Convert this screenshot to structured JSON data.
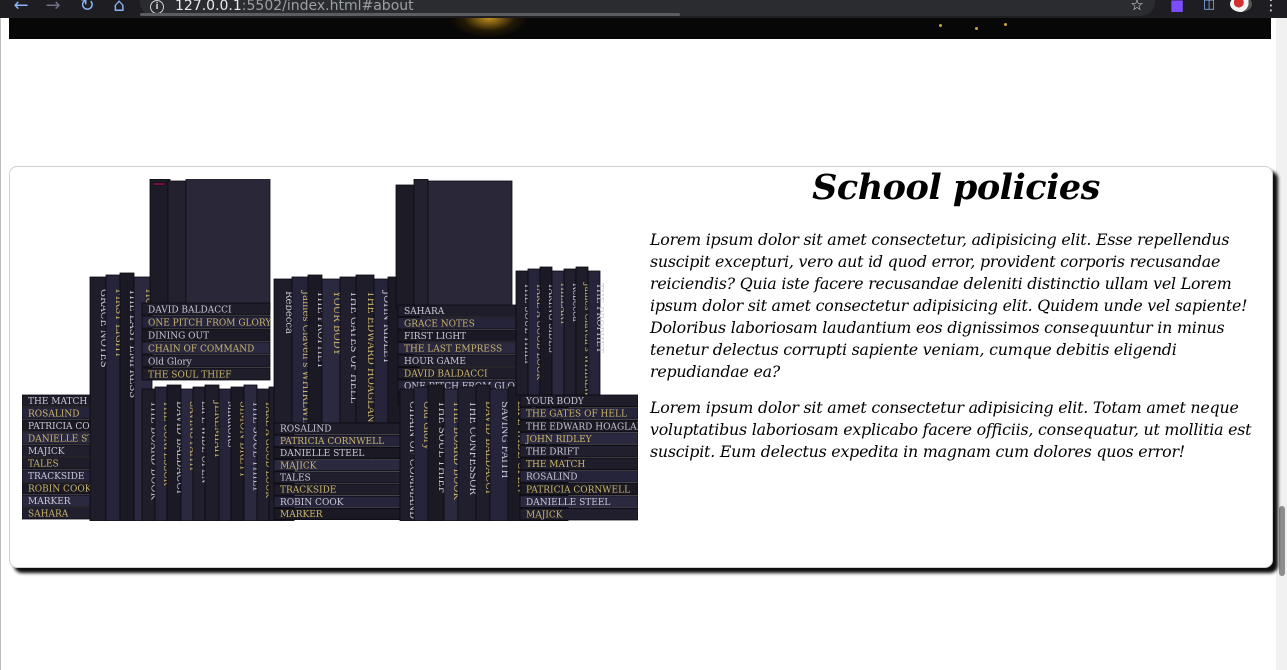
{
  "browser": {
    "url_host": "127.0.0.1",
    "url_rest": ":5502/index.html#about",
    "colors": {
      "chrome_bg": "#1e1e22",
      "omnibox_bg": "#2b2c30",
      "accent": "#8ab4f8",
      "extension": "#7c4dff"
    },
    "icons": [
      "back-arrow-icon",
      "forward-arrow-icon",
      "reload-icon",
      "home-icon",
      "info-icon",
      "star-icon",
      "puzzle-extension-icon",
      "cast-icon",
      "menu-dots-icon"
    ]
  },
  "about": {
    "title": "School policies",
    "paragraphs": [
      "Lorem ipsum dolor sit amet consectetur, adipisicing elit. Esse repellendus suscipit excepturi, vero aut id quod error, provident corporis recusandae reiciendis? Quia iste facere recusandae deleniti distinctio ullam vel Lorem ipsum dolor sit amet consectetur adipisicing elit. Quidem unde vel sapiente! Doloribus laboriosam laudantium eos dignissimos consequuntur in minus tenetur delectus corrupti sapiente veniam, cumque debitis eligendi repudiandae ea?",
      "Lorem ipsum dolor sit amet consectetur adipisicing elit. Totam amet neque voluptatibus laboriosam explicabo facere officiis, consequatur, ut mollitia est suscipit. Eum delectus expedita in magnam cum dolores quos error!"
    ],
    "image": {
      "subject": "black-books-stacks",
      "spine_titles": [
        "THE MATCH",
        "ROSALIND",
        "PATRICIA CORNWELL",
        "DANIELLE STEEL",
        "MAJICK",
        "TALES",
        "TRACKSIDE",
        "ROBIN COOK",
        "MARKER",
        "SAHARA",
        "GRACE NOTES",
        "FIRST LIGHT",
        "THE LAST EMPRESS",
        "HOUR GAME",
        "DAVID BALDACCI",
        "ONE PITCH FROM GLORY",
        "DINING OUT",
        "CHAIN OF COMMAND",
        "Old Glory",
        "THE SOUL THIEF",
        "THE BOARD BOOK",
        "THE CONFESSOR",
        "DAVID BALDACCI",
        "SAVING FAITH",
        "LIFE WIDE OPEN",
        "JEREMIAH",
        "MIRRORS",
        "SIMON BRETT",
        "THE SOUL THIEF",
        "TAKE A GOOD LOOK",
        "TAKING SIDES",
        "HILLARY",
        "Rebecca",
        "James Clavell's WHIRLWIND",
        "THE PROPHET",
        "YOUR BODY",
        "THE GATES OF HELL",
        "THE EDWARD HOAGLAND READER",
        "JOHN RIDLEY",
        "THE DRIFT"
      ],
      "colors": {
        "spine": "#1f1d2a",
        "gold": "#c9b56a",
        "silver": "#c9c7d2"
      }
    }
  }
}
